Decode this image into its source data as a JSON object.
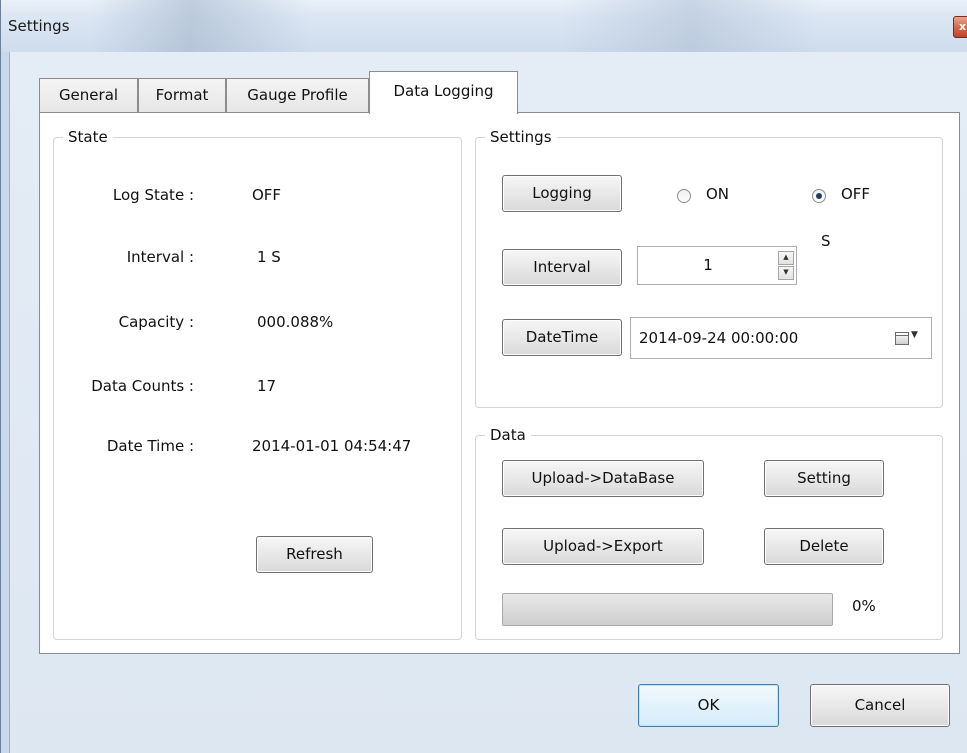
{
  "window": {
    "title": "Settings",
    "close_glyph": "x"
  },
  "tabs": [
    {
      "label": "General"
    },
    {
      "label": "Format"
    },
    {
      "label": "Gauge Profile"
    },
    {
      "label": "Data Logging",
      "active": true
    }
  ],
  "state": {
    "legend": "State",
    "rows": [
      {
        "label": "Log State :",
        "value": "OFF"
      },
      {
        "label": "Interval :",
        "value": "1 S"
      },
      {
        "label": "Capacity :",
        "value": "000.088%"
      },
      {
        "label": "Data Counts :",
        "value": "17"
      },
      {
        "label": "Date Time :",
        "value": "2014-01-01 04:54:47"
      }
    ],
    "refresh_label": "Refresh"
  },
  "settings": {
    "legend": "Settings",
    "logging_label": "Logging",
    "on_label": "ON",
    "off_label": "OFF",
    "selected": "OFF",
    "interval_label": "Interval",
    "interval_value": "1",
    "interval_unit": "S",
    "datetime_label": "DateTime",
    "datetime_value": "2014-09-24 00:00:00"
  },
  "data": {
    "legend": "Data",
    "upload_db_label": "Upload->DataBase",
    "setting_label": "Setting",
    "upload_export_label": "Upload->Export",
    "delete_label": "Delete",
    "progress_percent": 0,
    "progress_text": "0%"
  },
  "footer": {
    "ok_label": "OK",
    "cancel_label": "Cancel"
  },
  "icons": {
    "calendar": "calendar-icon",
    "dropdown": "chevron-down-icon",
    "spin_up": "spin-up-icon",
    "spin_down": "spin-down-icon"
  },
  "colors": {
    "progress_fill": "#3cb34a",
    "titlebar": "#dbe6f3",
    "close": "#c24125"
  }
}
